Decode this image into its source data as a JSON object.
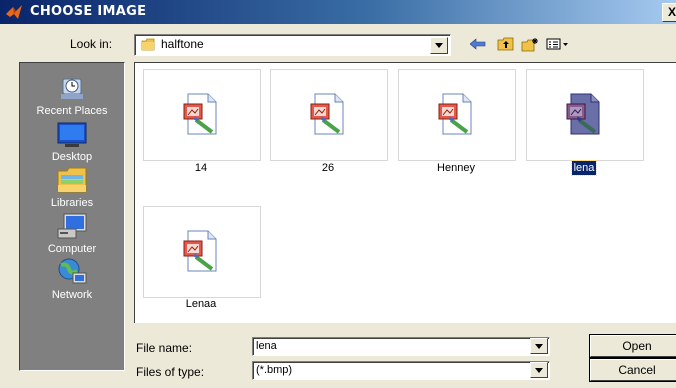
{
  "window": {
    "title": "CHOOSE IMAGE",
    "close_label": "X"
  },
  "lookin": {
    "label": "Look in:",
    "value": "halftone"
  },
  "toolbar": {
    "icons": [
      "back-arrow-icon",
      "up-folder-icon",
      "new-folder-icon",
      "view-menu-icon"
    ]
  },
  "places": [
    {
      "label": "Recent Places",
      "icon": "recent-places-icon"
    },
    {
      "label": "Desktop",
      "icon": "desktop-icon"
    },
    {
      "label": "Libraries",
      "icon": "libraries-icon"
    },
    {
      "label": "Computer",
      "icon": "computer-icon"
    },
    {
      "label": "Network",
      "icon": "network-icon"
    }
  ],
  "files": [
    {
      "name": "14",
      "selected": false
    },
    {
      "name": "26",
      "selected": false
    },
    {
      "name": "Henney",
      "selected": false
    },
    {
      "name": "lena",
      "selected": true
    },
    {
      "name": "Lenaa",
      "selected": false
    }
  ],
  "filename": {
    "label": "File name:",
    "value": "lena"
  },
  "filetype": {
    "label": "Files of type:",
    "value": "(*.bmp)"
  },
  "buttons": {
    "open": "Open",
    "cancel": "Cancel"
  },
  "colors": {
    "selection": "#0a246a",
    "places_bg": "#808080",
    "dialog_bg": "#ece9d8"
  }
}
